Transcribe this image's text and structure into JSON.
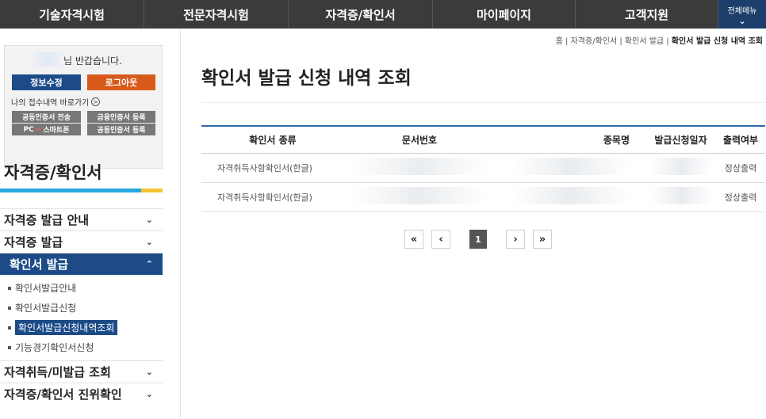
{
  "topnav": {
    "items": [
      "기술자격시험",
      "전문자격시험",
      "자격증/확인서",
      "마이페이지",
      "고객지원"
    ],
    "menu_all": "전체메뉴"
  },
  "sidebar": {
    "greeting": "님 반갑습니다.",
    "edit_button": "정보수정",
    "logout_button": "로그아웃",
    "shortcut": "나의 접수내역 바로가기",
    "cert_send": "공동인증서 전송",
    "fin_cert": "금융인증서 등록",
    "pc_to_phone_pc": "PC",
    "pc_to_phone_phone": "스마트폰",
    "joint_cert": "공동인증서 등록",
    "title": "자격증/확인서",
    "menu": [
      {
        "label": "자격증 발급 안내"
      },
      {
        "label": "자격증 발급"
      },
      {
        "label": "확인서 발급",
        "active": true
      }
    ],
    "submenu": [
      "확인서발급안내",
      "확인서발급신청",
      "확인서발급신청내역조회",
      "기능경기확인서신청"
    ],
    "menu_after": [
      {
        "label": "자격취득/미발급 조회"
      },
      {
        "label": "자격증/확인서 진위확인"
      }
    ]
  },
  "breadcrumb": {
    "home": "홈",
    "level1": "자격증/확인서",
    "level2": "확인서 발급",
    "current": "확인서 발급 신청 내역 조회"
  },
  "page_title": "확인서 발급 신청 내역 조회",
  "table": {
    "headers": [
      "확인서 종류",
      "문서번호",
      "종목명",
      "발급신청일자",
      "출력여부"
    ],
    "rows": [
      {
        "type": "자격취득사항확인서(한글)",
        "doc_no": "",
        "item": "",
        "date": "",
        "status": "정상출력"
      },
      {
        "type": "자격취득사항확인서(한글)",
        "doc_no": "",
        "item": "",
        "date": "",
        "status": "정상출력"
      }
    ]
  },
  "pager": {
    "first": "«",
    "prev": "‹",
    "current": "1",
    "next": "›",
    "last": "»"
  }
}
